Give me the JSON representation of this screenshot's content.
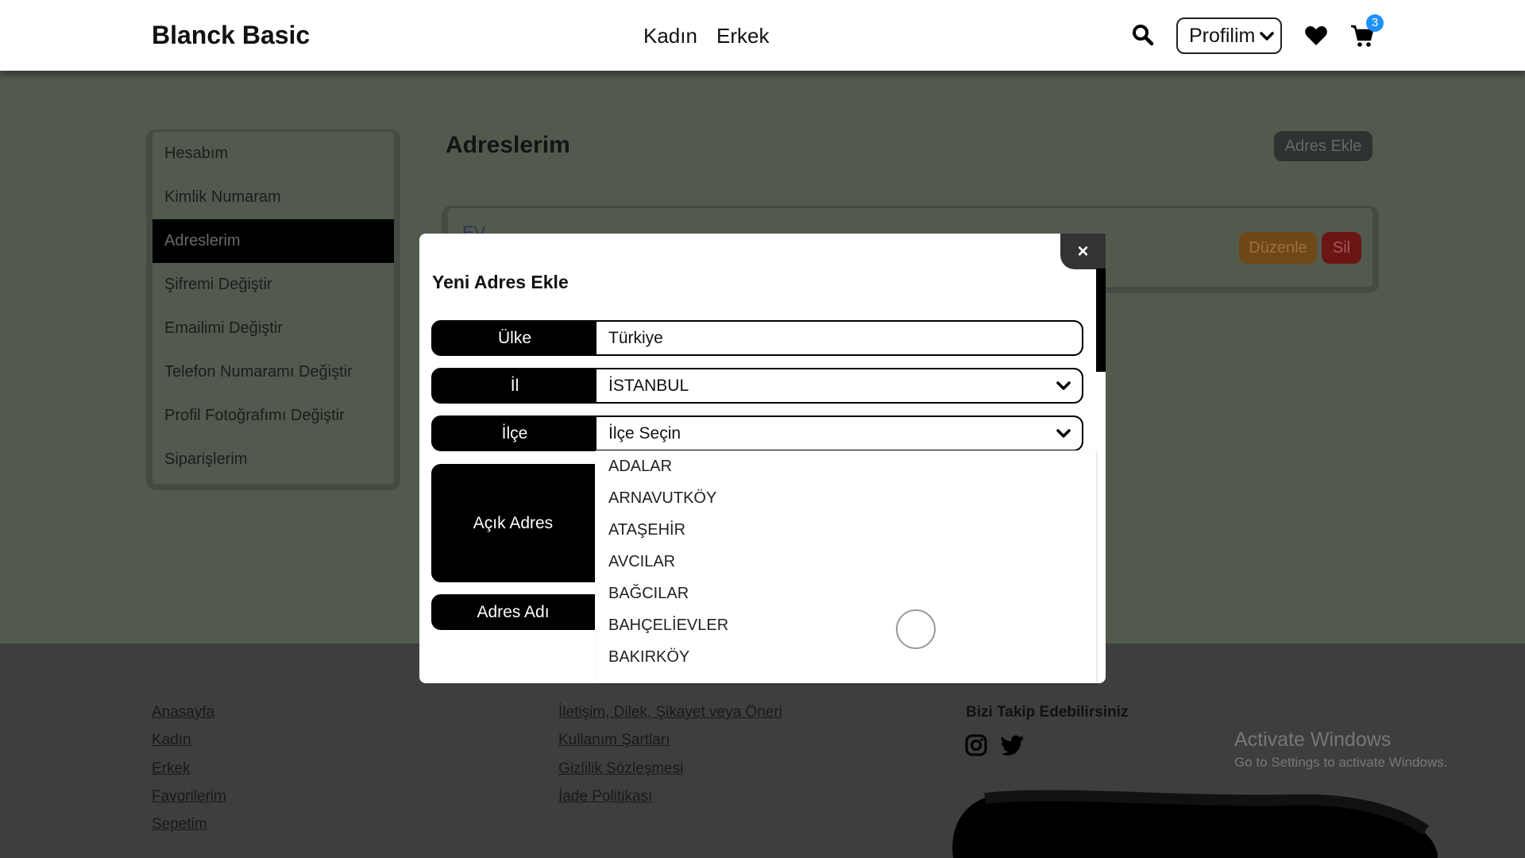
{
  "header": {
    "brand": "Blanck Basic",
    "nav": [
      "Kadın",
      "Erkek"
    ],
    "profile_label": "Profilim",
    "cart_count": "3"
  },
  "sidebar": {
    "items": [
      {
        "label": "Hesabım",
        "active": false
      },
      {
        "label": "Kimlik Numaram",
        "active": false
      },
      {
        "label": "Adreslerim",
        "active": true
      },
      {
        "label": "Şifremi Değiştir",
        "active": false
      },
      {
        "label": "Emailimi Değiştir",
        "active": false
      },
      {
        "label": "Telefon Numaramı Değiştir",
        "active": false
      },
      {
        "label": "Profil Fotoğrafımı Değiştir",
        "active": false
      },
      {
        "label": "Siparişlerim",
        "active": false
      }
    ]
  },
  "content": {
    "title": "Adreslerim",
    "add_button": "Adres Ekle",
    "address_card": {
      "name": "EV",
      "edit_label": "Düzenle",
      "delete_label": "Sil"
    }
  },
  "modal": {
    "title": "Yeni Adres Ekle",
    "close_label": "×",
    "fields": {
      "country_label": "Ülke",
      "country_value": "Türkiye",
      "city_label": "İl",
      "city_value": "İSTANBUL",
      "district_label": "İlçe",
      "district_placeholder": "İlçe Seçin",
      "open_address_label": "Açık Adres",
      "address_name_label": "Adres Adı"
    },
    "district_options": [
      "ADALAR",
      "ARNAVUTKÖY",
      "ATAŞEHİR",
      "AVCILAR",
      "BAĞCILAR",
      "BAHÇELİEVLER",
      "BAKIRKÖY"
    ]
  },
  "footer": {
    "col1": [
      "Anasayfa",
      "Kadın",
      "Erkek",
      "Favorilerim",
      "Sepetim"
    ],
    "col2": [
      "İletişim, Dilek, Şikayet veya Öneri",
      "Kullanım Şartları",
      "Gizlilik Sözleşmesi",
      "İade Politikası"
    ],
    "follow_title": "Bizi Takip Edebilirsiniz"
  },
  "watermark": {
    "title": "Activate Windows",
    "subtitle": "Go to Settings to activate Windows."
  },
  "icons": {
    "search": "search-icon",
    "heart": "heart-icon",
    "cart": "cart-icon",
    "chevron": "chevron-down-icon",
    "instagram": "instagram-icon",
    "twitter": "twitter-icon"
  },
  "colors": {
    "overlay": "#525a4e",
    "footer": "#3e3e3e",
    "badge": "#1e90ff",
    "edit": "#6e4816",
    "delete": "#6b1515"
  }
}
